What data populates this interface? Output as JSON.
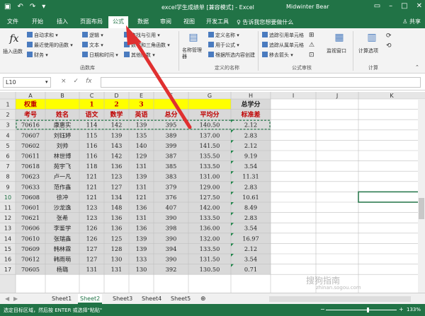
{
  "titlebar": {
    "title": "excel学生成绩单 [兼容模式] - Excel",
    "user": "Midwinter Bear",
    "save_icon": "save-icon",
    "undo_icon": "undo-icon",
    "redo_icon": "redo-icon"
  },
  "tabs": [
    "文件",
    "开始",
    "插入",
    "页面布局",
    "公式",
    "数据",
    "审阅",
    "视图",
    "开发工具"
  ],
  "active_tab": "公式",
  "tell_me": "告诉我您想要做什么",
  "share": "共享",
  "ribbon": {
    "insert_function": "插入函数",
    "autosum": "自动求和",
    "recent": "最近使用的函数",
    "financial": "财务",
    "logical": "逻辑",
    "text": "文本",
    "datetime": "日期和时间",
    "lookup": "查找与引用",
    "math": "数学和三角函数",
    "more": "其他函数",
    "library_group": "函数库",
    "define_name": "定义名称",
    "use_in_formula": "用于公式",
    "create_from_sel": "根据所选内容创建",
    "name_manager": "名称管理器",
    "names_group": "定义的名称",
    "trace_precedents": "追踪引用单元格",
    "trace_dependents": "追踪从属单元格",
    "remove_arrows": "移去箭头",
    "watch_window": "监视窗口",
    "audit_group": "公式审核",
    "calc_options": "计算选项",
    "calc_group": "计算"
  },
  "formula_bar": {
    "name_box": "L10",
    "cancel": "×",
    "enter": "✓",
    "fx": "fx"
  },
  "columns": [
    "A",
    "B",
    "C",
    "D",
    "E",
    "F",
    "G",
    "H",
    "I",
    "J",
    "K"
  ],
  "rows": [
    {
      "n": "1",
      "cells": [
        "权重",
        "",
        "1",
        "2",
        "3",
        "",
        "",
        "总学分"
      ]
    },
    {
      "n": "2",
      "cells": [
        "考号",
        "姓名",
        "语文",
        "数学",
        "英语",
        "总分",
        "平均分",
        "标准差"
      ]
    },
    {
      "n": "3",
      "cells": [
        "70616",
        "康惠实",
        "114",
        "142",
        "139",
        "395",
        "140.50",
        "2.12"
      ]
    },
    {
      "n": "4",
      "cells": [
        "70607",
        "刘钰婷",
        "115",
        "139",
        "135",
        "389",
        "137.00",
        "2.83"
      ]
    },
    {
      "n": "5",
      "cells": [
        "70602",
        "刘帅",
        "116",
        "143",
        "140",
        "399",
        "141.50",
        "2.12"
      ]
    },
    {
      "n": "6",
      "cells": [
        "70611",
        "林世博",
        "116",
        "142",
        "129",
        "387",
        "135.50",
        "9.19"
      ]
    },
    {
      "n": "7",
      "cells": [
        "70618",
        "苑宇飞",
        "118",
        "136",
        "131",
        "385",
        "133.50",
        "3.54"
      ]
    },
    {
      "n": "8",
      "cells": [
        "70623",
        "卢一凡",
        "121",
        "123",
        "139",
        "383",
        "131.00",
        "11.31"
      ]
    },
    {
      "n": "9",
      "cells": [
        "70633",
        "范作鑫",
        "121",
        "127",
        "131",
        "379",
        "129.00",
        "2.83"
      ]
    },
    {
      "n": "10",
      "cells": [
        "70608",
        "徐冲",
        "121",
        "134",
        "121",
        "376",
        "127.50",
        "10.61"
      ]
    },
    {
      "n": "11",
      "cells": [
        "70601",
        "沙龙逸",
        "123",
        "148",
        "136",
        "407",
        "142.00",
        "8.49"
      ]
    },
    {
      "n": "12",
      "cells": [
        "70621",
        "张希",
        "123",
        "136",
        "131",
        "390",
        "133.50",
        "2.83"
      ]
    },
    {
      "n": "13",
      "cells": [
        "70606",
        "李鉴学",
        "126",
        "136",
        "136",
        "398",
        "136.00",
        "3.54"
      ]
    },
    {
      "n": "14",
      "cells": [
        "70610",
        "张瑞鑫",
        "126",
        "125",
        "139",
        "390",
        "132.00",
        "16.97"
      ]
    },
    {
      "n": "15",
      "cells": [
        "70609",
        "韩林霖",
        "127",
        "128",
        "139",
        "394",
        "133.50",
        "2.12"
      ]
    },
    {
      "n": "16",
      "cells": [
        "70612",
        "韩雨萌",
        "127",
        "130",
        "133",
        "390",
        "131.50",
        "3.54"
      ]
    },
    {
      "n": "17",
      "cells": [
        "70605",
        "杨璐",
        "131",
        "131",
        "130",
        "392",
        "130.50",
        "0.71"
      ]
    }
  ],
  "sheets": [
    "Sheet1",
    "Sheet2",
    "Sheet3",
    "Sheet4",
    "Sheet5"
  ],
  "active_sheet": "Sheet2",
  "status": "选定目标区域，然后按 ENTER 或选择\"粘贴\"",
  "zoom": "133%",
  "watermark": "搜狗指南",
  "watermark_sub": "zhinan.sogou.com",
  "colors": {
    "excel_green": "#217346",
    "yellow": "#ffff00",
    "gray": "#d9d9d9",
    "arrow": "#e03030"
  }
}
